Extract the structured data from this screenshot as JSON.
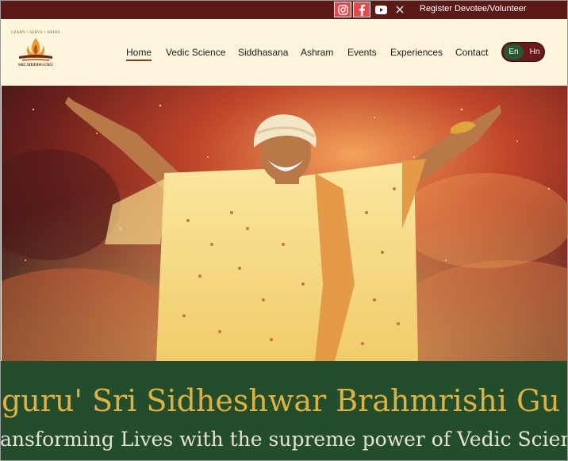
{
  "topbar": {
    "social": [
      "instagram-icon",
      "facebook-icon",
      "youtube-icon",
      "x-icon"
    ],
    "register_label": "Register Devotee/Volunteer"
  },
  "logo": {
    "tagline": "LEARN • SERVE • ABIDE",
    "name": "SRI SIDDHGURU"
  },
  "nav": {
    "items": [
      "Home",
      "Vedic Science",
      "Siddhasana",
      "Ashram",
      "Events",
      "Experiences",
      "Contact"
    ],
    "active": "Home"
  },
  "lang": {
    "en": "En",
    "hn": "Hn",
    "active": "En"
  },
  "hero": {
    "description": ""
  },
  "banner": {
    "title": "guru' Sri Sidheshwar Brahmrishi Gu",
    "subtitle": "ansforming Lives with the supreme power of Vedic Scienc"
  },
  "colors": {
    "topbar": "#5c1a17",
    "header": "#fdf6dd",
    "banner": "#234e2d",
    "title": "#e2b13c",
    "social": "#e8474c"
  }
}
